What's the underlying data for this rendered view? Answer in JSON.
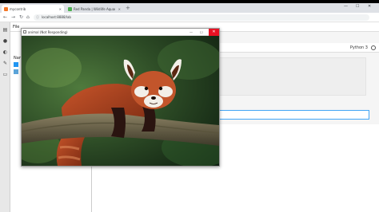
{
  "browser": {
    "tabs": [
      {
        "label": "mycontrib",
        "active": true
      },
      {
        "label": "Red Panda | Wildlife Aquari | Ro",
        "active": false
      }
    ],
    "new_tab": "+",
    "minimize": "—",
    "maximize": "☐",
    "close": "✕",
    "url": "localhost:8888/lab"
  },
  "jupyter": {
    "file_menu": "File",
    "name_column": "Nam",
    "kernel": "Python 3"
  },
  "popup": {
    "title": "animal (Not Responding)",
    "close_label": "✕",
    "minimize_label": "—",
    "maximize_label": "☐"
  },
  "colors": {
    "close_red": "#e81123",
    "accent_blue": "#42a5f5"
  }
}
